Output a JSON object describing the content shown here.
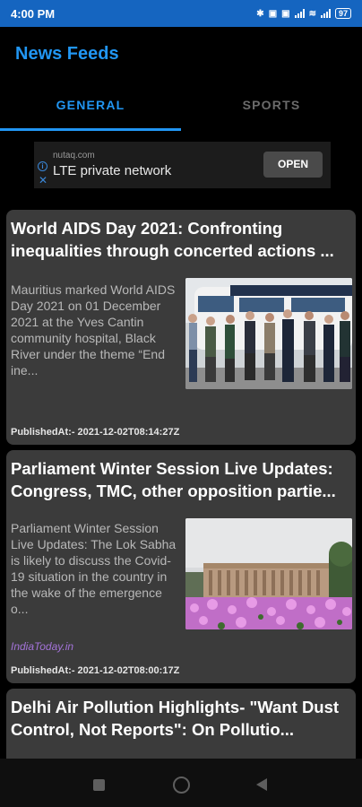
{
  "status_bar": {
    "time": "4:00 PM",
    "battery": "97"
  },
  "app": {
    "title": "News Feeds"
  },
  "tabs": [
    {
      "label": "GENERAL",
      "active": true
    },
    {
      "label": "SPORTS",
      "active": false
    }
  ],
  "ad": {
    "domain": "nutaq.com",
    "title": "LTE private network",
    "button": "OPEN",
    "info_icon": "info-icon",
    "close_icon": "close-icon"
  },
  "articles": [
    {
      "title": "World AIDS Day 2021: Confronting inequalities through concerted actions ...",
      "description": "Mauritius marked World AIDS Day 2021 on 01 December 2021 at the Yves Cantin community hospital, Black River under the theme “End ine...",
      "source": "",
      "published": "PublishedAt:- 2021-12-02T08:14:27Z",
      "image": "group-photo-in-front-of-bus"
    },
    {
      "title": "Parliament Winter Session Live Updates: Congress, TMC, other opposition partie...",
      "description": "Parliament Winter Session Live Updates: The Lok Sabha is likely to discuss the Covid-19 situation in the country in the wake of the emergence o...",
      "source": "IndiaToday.in",
      "published": "PublishedAt:- 2021-12-02T08:00:17Z",
      "image": "parliament-building-with-flowers"
    },
    {
      "title": "Delhi Air Pollution Highlights- \"Want Dust Control, Not Reports\": On Pollutio...",
      "description": "",
      "source": "",
      "published": "",
      "image": ""
    }
  ]
}
